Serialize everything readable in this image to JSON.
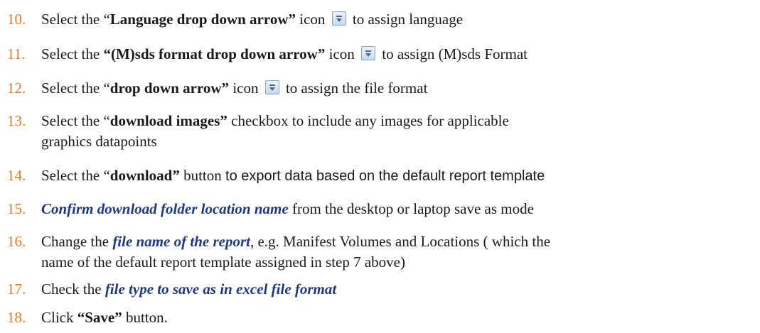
{
  "steps": [
    {
      "num": "10.",
      "t1": "Select the “",
      "b1": "Language drop down arrow”",
      "t2": " icon",
      "t3": " to assign language"
    },
    {
      "num": "11.",
      "t1": "Select the ",
      "b1": "“(M)sds format drop down arrow”",
      "t2": " icon",
      "t3": " to assign (M)sds Format"
    },
    {
      "num": "12.",
      "t1": "Select the “",
      "b1": "drop down arrow”",
      "t2": " icon",
      "t3": " to assign the file format"
    },
    {
      "num": "13.",
      "t1": "Select the “",
      "b1": "download images”",
      "t2": " checkbox to include any images for applicable",
      "line2": "graphics datapoints"
    },
    {
      "num": "14.",
      "t1": "Select the “",
      "b1": "download”",
      "t2": " button  ",
      "t3": "to export data based on the default report template"
    },
    {
      "num": "15.",
      "bi1": "Confirm download folder location name",
      "t2": " from the desktop or laptop save as mode"
    },
    {
      "num": "16.",
      "t1": "Change the ",
      "bi1": "file name of the report",
      "t2": ", e.g. Manifest Volumes and Locations ( which the",
      "line2": "name of the default report template assigned in step 7 above)"
    },
    {
      "num": "17.",
      "t1": "Check the ",
      "bi1": "file type to save as in excel file format"
    },
    {
      "num": "18.",
      "t1": "Click ",
      "b1": "“Save”",
      "t2": " button."
    }
  ],
  "icons": {
    "dropdown": "dropdown-arrow-icon"
  },
  "colors": {
    "number": "#e07a2a",
    "emphasis": "#1f3a7a"
  }
}
